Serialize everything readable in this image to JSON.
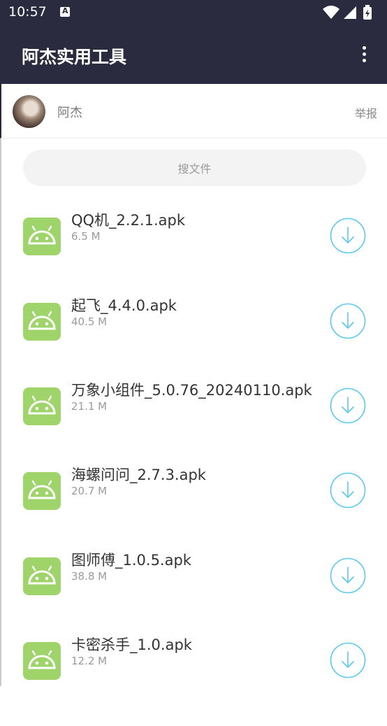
{
  "status_bar": {
    "time": "10:57"
  },
  "app_bar": {
    "title": "阿杰实用工具"
  },
  "user": {
    "name": "阿杰",
    "report_label": "举报"
  },
  "search": {
    "placeholder": "搜文件"
  },
  "files": [
    {
      "name": "QQ机_2.2.1.apk",
      "size": "6.5 M"
    },
    {
      "name": "起飞_4.4.0.apk",
      "size": "40.5 M"
    },
    {
      "name": "万象小组件_5.0.76_20240110.apk",
      "size": "21.1 M"
    },
    {
      "name": "海螺问问_2.7.3.apk",
      "size": "20.7 M"
    },
    {
      "name": "图师傅_1.0.5.apk",
      "size": "38.8 M"
    },
    {
      "name": "卡密杀手_1.0.apk",
      "size": "12.2 M"
    }
  ],
  "colors": {
    "app_bar": "#2b2b3f",
    "android_icon_bg": "#9ed46a",
    "download_accent": "#5bc8f0"
  }
}
